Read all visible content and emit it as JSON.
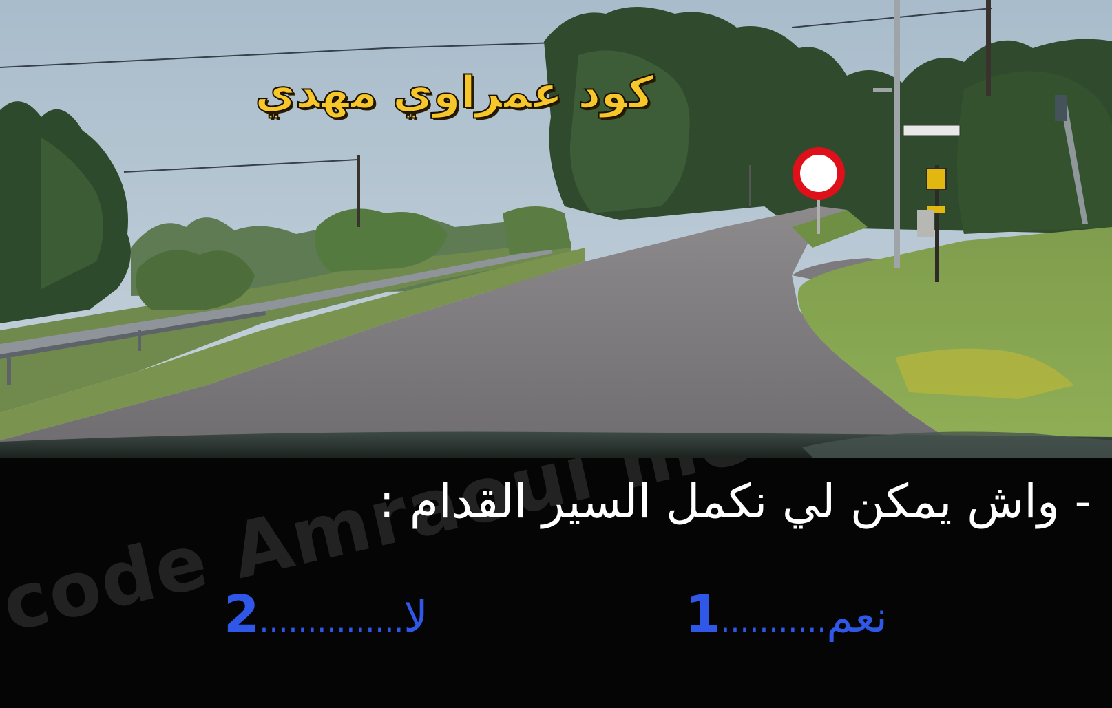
{
  "overlay_title": "كود عمراوي مهدي",
  "quiz": {
    "question": "- واش يمكن لي نكمل السير القدام :",
    "answers": [
      {
        "number": "1",
        "dots": "...........",
        "label": "نعم"
      },
      {
        "number": "2",
        "dots": "...............",
        "label": "لا"
      }
    ],
    "watermark": "code Amraoui mehdi"
  },
  "colors": {
    "title": "#f6c62a",
    "answer": "#2f57e8",
    "question": "#ffffff",
    "panel": "#050505",
    "sign_ring": "#e0101a"
  }
}
